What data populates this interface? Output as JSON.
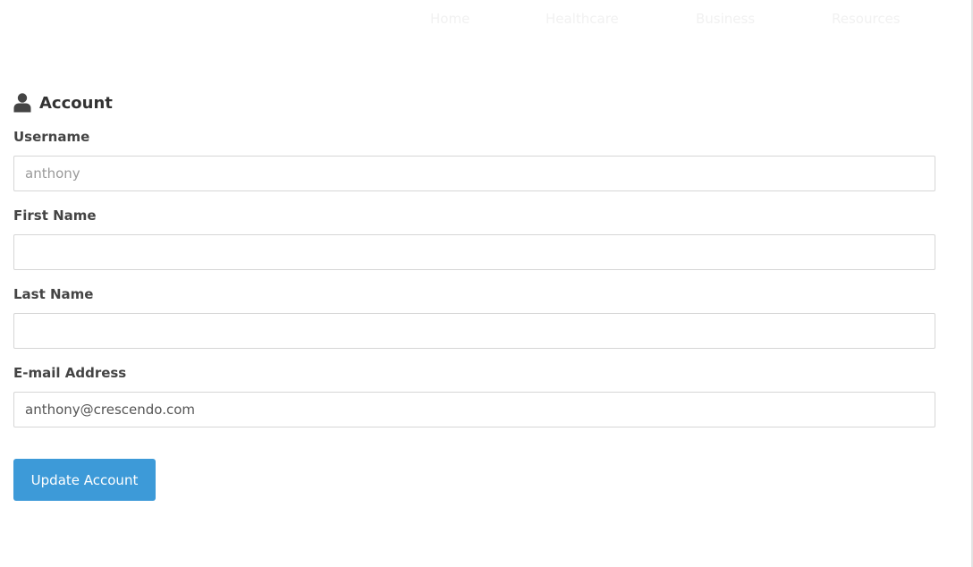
{
  "nav": {
    "items": [
      {
        "label": "Home"
      },
      {
        "label": "Healthcare"
      },
      {
        "label": "Business"
      },
      {
        "label": "Resources"
      }
    ],
    "color": "#f1f1f1"
  },
  "account": {
    "icon": "user-icon",
    "title": "Account",
    "fields": {
      "username": {
        "label": "Username",
        "value": "anthony",
        "readonly": true
      },
      "first_name": {
        "label": "First Name",
        "value": ""
      },
      "last_name": {
        "label": "Last Name",
        "value": ""
      },
      "email": {
        "label": "E-mail Address",
        "value": "anthony@crescendo.com"
      }
    },
    "submit_label": "Update Account"
  },
  "colors": {
    "accent": "#3d9ad8",
    "text": "#333333",
    "border": "#d6d6d6"
  }
}
